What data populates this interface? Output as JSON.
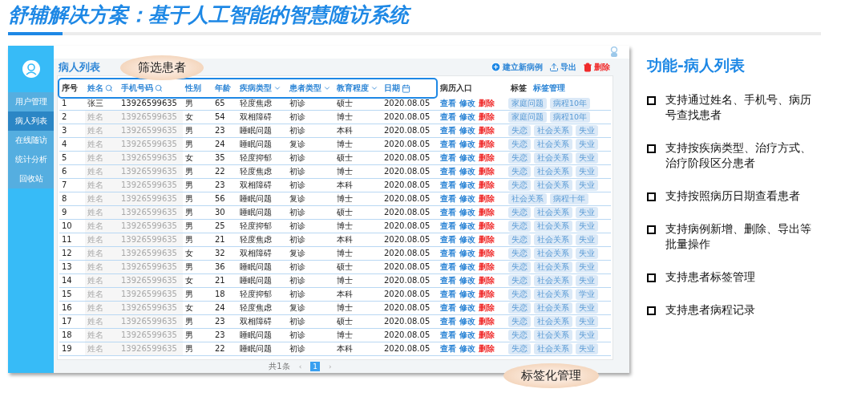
{
  "slide_title": "舒辅解决方案：基于人工智能的智慧随访系统",
  "app": {
    "sidebar": {
      "items": [
        {
          "label": "用户管理",
          "selected": false
        },
        {
          "label": "病人列表",
          "selected": true
        },
        {
          "label": "在线随访",
          "selected": false
        },
        {
          "label": "统计分析",
          "selected": false
        },
        {
          "label": "回收站",
          "selected": false
        }
      ]
    },
    "page_title": "病人列表",
    "toolbar": [
      {
        "label": "建立新病例",
        "kind": "add"
      },
      {
        "label": "导出",
        "kind": "export"
      },
      {
        "label": "删除",
        "kind": "delete"
      }
    ],
    "table": {
      "columns": [
        {
          "label": "序号",
          "kind": "plain"
        },
        {
          "label": "姓名",
          "kind": "search"
        },
        {
          "label": "手机号码",
          "kind": "search"
        },
        {
          "label": "性别",
          "kind": "filter"
        },
        {
          "label": "年龄",
          "kind": "filter"
        },
        {
          "label": "疾病类型",
          "kind": "dropdown"
        },
        {
          "label": "患者类型",
          "kind": "dropdown"
        },
        {
          "label": "教育程度",
          "kind": "dropdown"
        },
        {
          "label": "日期",
          "kind": "date"
        },
        {
          "label": "病历入口",
          "kind": "plain"
        },
        {
          "label": "标签",
          "kind": "plain"
        }
      ],
      "tag_manage_link": "标签管理",
      "rows": [
        {
          "no": "1",
          "name": "张三",
          "phone": "13926599635",
          "masked": false,
          "sex": "男",
          "age": "65",
          "disease": "轻度焦虑",
          "type": "初诊",
          "edu": "硕士",
          "date": "2020.08.05",
          "actions": [
            "查看",
            "修改",
            "删除"
          ],
          "tags": [
            "家庭问题",
            "病程10年"
          ]
        },
        {
          "no": "2",
          "name": "姓名",
          "phone": "13926599635",
          "masked": true,
          "sex": "女",
          "age": "54",
          "disease": "双相障碍",
          "type": "初诊",
          "edu": "博士",
          "date": "2020.08.05",
          "actions": [
            "查看",
            "修改",
            "删除"
          ],
          "tags": [
            "家庭问题",
            "病程10年"
          ]
        },
        {
          "no": "3",
          "name": "姓名",
          "phone": "13926599635",
          "masked": true,
          "sex": "男",
          "age": "23",
          "disease": "睡眠问题",
          "type": "初诊",
          "edu": "本科",
          "date": "2020.08.05",
          "actions": [
            "查看",
            "修改",
            "删除"
          ],
          "tags": [
            "失恋",
            "社会关系",
            "失业"
          ]
        },
        {
          "no": "4",
          "name": "姓名",
          "phone": "13926599635",
          "masked": true,
          "sex": "男",
          "age": "24",
          "disease": "睡眠问题",
          "type": "复诊",
          "edu": "博士",
          "date": "2020.08.05",
          "actions": [
            "查看",
            "修改",
            "删除"
          ],
          "tags": [
            "失恋",
            "社会关系",
            "失业"
          ]
        },
        {
          "no": "5",
          "name": "姓名",
          "phone": "13926599635",
          "masked": true,
          "sex": "女",
          "age": "35",
          "disease": "轻度抑郁",
          "type": "初诊",
          "edu": "硕士",
          "date": "2020.08.05",
          "actions": [
            "查看",
            "修改",
            "删除"
          ],
          "tags": [
            "失恋",
            "社会关系",
            "失业"
          ]
        },
        {
          "no": "6",
          "name": "姓名",
          "phone": "13926599635",
          "masked": true,
          "sex": "男",
          "age": "22",
          "disease": "轻度焦虑",
          "type": "初诊",
          "edu": "博士",
          "date": "2020.08.05",
          "actions": [
            "查看",
            "修改",
            "删除"
          ],
          "tags": [
            "失恋",
            "社会关系",
            "失业"
          ]
        },
        {
          "no": "7",
          "name": "姓名",
          "phone": "13926599635",
          "masked": true,
          "sex": "男",
          "age": "23",
          "disease": "双相障碍",
          "type": "初诊",
          "edu": "本科",
          "date": "2020.08.05",
          "actions": [
            "查看",
            "修改",
            "删除"
          ],
          "tags": [
            "失恋",
            "社会关系",
            "失业"
          ]
        },
        {
          "no": "8",
          "name": "姓名",
          "phone": "13926599635",
          "masked": true,
          "sex": "男",
          "age": "56",
          "disease": "睡眠问题",
          "type": "复诊",
          "edu": "博士",
          "date": "2020.08.05",
          "actions": [
            "查看",
            "修改",
            "删除"
          ],
          "tags": [
            "社会关系",
            "病程十年"
          ]
        },
        {
          "no": "9",
          "name": "姓名",
          "phone": "13926599635",
          "masked": true,
          "sex": "男",
          "age": "30",
          "disease": "睡眠问题",
          "type": "初诊",
          "edu": "硕士",
          "date": "2020.08.05",
          "actions": [
            "查看",
            "修改",
            "删除"
          ],
          "tags": [
            "失恋",
            "社会关系",
            "失业"
          ]
        },
        {
          "no": "10",
          "name": "姓名",
          "phone": "13926599635",
          "masked": true,
          "sex": "男",
          "age": "25",
          "disease": "轻度抑郁",
          "type": "初诊",
          "edu": "博士",
          "date": "2020.08.05",
          "actions": [
            "查看",
            "修改",
            "删除"
          ],
          "tags": [
            "失恋",
            "社会关系",
            "失业"
          ]
        },
        {
          "no": "11",
          "name": "姓名",
          "phone": "13926599635",
          "masked": true,
          "sex": "男",
          "age": "21",
          "disease": "轻度焦虑",
          "type": "初诊",
          "edu": "本科",
          "date": "2020.08.05",
          "actions": [
            "查看",
            "修改",
            "删除"
          ],
          "tags": [
            "失恋",
            "社会关系",
            "失业"
          ]
        },
        {
          "no": "12",
          "name": "姓名",
          "phone": "13926599635",
          "masked": true,
          "sex": "女",
          "age": "32",
          "disease": "双相障碍",
          "type": "复诊",
          "edu": "博士",
          "date": "2020.08.05",
          "actions": [
            "查看",
            "修改",
            "删除"
          ],
          "tags": [
            "失恋",
            "社会关系",
            "失业"
          ]
        },
        {
          "no": "13",
          "name": "姓名",
          "phone": "13926599635",
          "masked": true,
          "sex": "男",
          "age": "36",
          "disease": "睡眠问题",
          "type": "初诊",
          "edu": "硕士",
          "date": "2020.08.05",
          "actions": [
            "查看",
            "修改",
            "删除"
          ],
          "tags": [
            "失恋",
            "社会关系",
            "失业"
          ]
        },
        {
          "no": "14",
          "name": "姓名",
          "phone": "13926599635",
          "masked": true,
          "sex": "女",
          "age": "21",
          "disease": "睡眠问题",
          "type": "初诊",
          "edu": "博士",
          "date": "2020.08.05",
          "actions": [
            "查看",
            "修改",
            "删除"
          ],
          "tags": [
            "失恋",
            "社会关系",
            "失业"
          ]
        },
        {
          "no": "15",
          "name": "姓名",
          "phone": "13926599635",
          "masked": true,
          "sex": "男",
          "age": "18",
          "disease": "轻度抑郁",
          "type": "初诊",
          "edu": "本科",
          "date": "2020.08.05",
          "actions": [
            "查看",
            "修改",
            "删除"
          ],
          "tags": [
            "失恋",
            "社会关系",
            "学业"
          ]
        },
        {
          "no": "16",
          "name": "姓名",
          "phone": "13926599635",
          "masked": true,
          "sex": "女",
          "age": "24",
          "disease": "轻度焦虑",
          "type": "复诊",
          "edu": "博士",
          "date": "2020.08.05",
          "actions": [
            "查看",
            "修改",
            "删除"
          ],
          "tags": [
            "失恋",
            "社会关系",
            "失业"
          ]
        },
        {
          "no": "17",
          "name": "姓名",
          "phone": "13926599635",
          "masked": true,
          "sex": "男",
          "age": "23",
          "disease": "双相障碍",
          "type": "初诊",
          "edu": "硕士",
          "date": "2020.08.05",
          "actions": [
            "查看",
            "修改",
            "删除"
          ],
          "tags": [
            "失恋",
            "社会关系",
            "失业"
          ]
        },
        {
          "no": "18",
          "name": "姓名",
          "phone": "13926599635",
          "masked": true,
          "sex": "男",
          "age": "23",
          "disease": "睡眠问题",
          "type": "初诊",
          "edu": "博士",
          "date": "2020.08.05",
          "actions": [
            "查看",
            "修改",
            "删除"
          ],
          "tags": [
            "失恋",
            "社会关系",
            "失业"
          ]
        },
        {
          "no": "19",
          "name": "姓名",
          "phone": "13926599635",
          "masked": true,
          "sex": "男",
          "age": "22",
          "disease": "睡眠问题",
          "type": "初诊",
          "edu": "本科",
          "date": "2020.08.05",
          "actions": [
            "查看",
            "修改",
            "删除"
          ],
          "tags": [
            "失恋",
            "社会关系",
            "失业"
          ]
        }
      ]
    },
    "pagination": {
      "total": "共1条",
      "prev": "‹",
      "pages": [
        {
          "label": "1",
          "selected": true
        }
      ],
      "next": "›"
    }
  },
  "callouts": [
    "筛选患者",
    "标签化管理"
  ],
  "features": {
    "title": "功能-病人列表",
    "items": [
      "支持通过姓名、手机号、病历号查找患者",
      "支持按疾病类型、治疗方式、治疗阶段区分患者",
      "支持按照病历日期查看患者",
      "支持病例新增、删除、导出等批量操作",
      "支持患者标签管理",
      "支持患者病程记录"
    ]
  }
}
